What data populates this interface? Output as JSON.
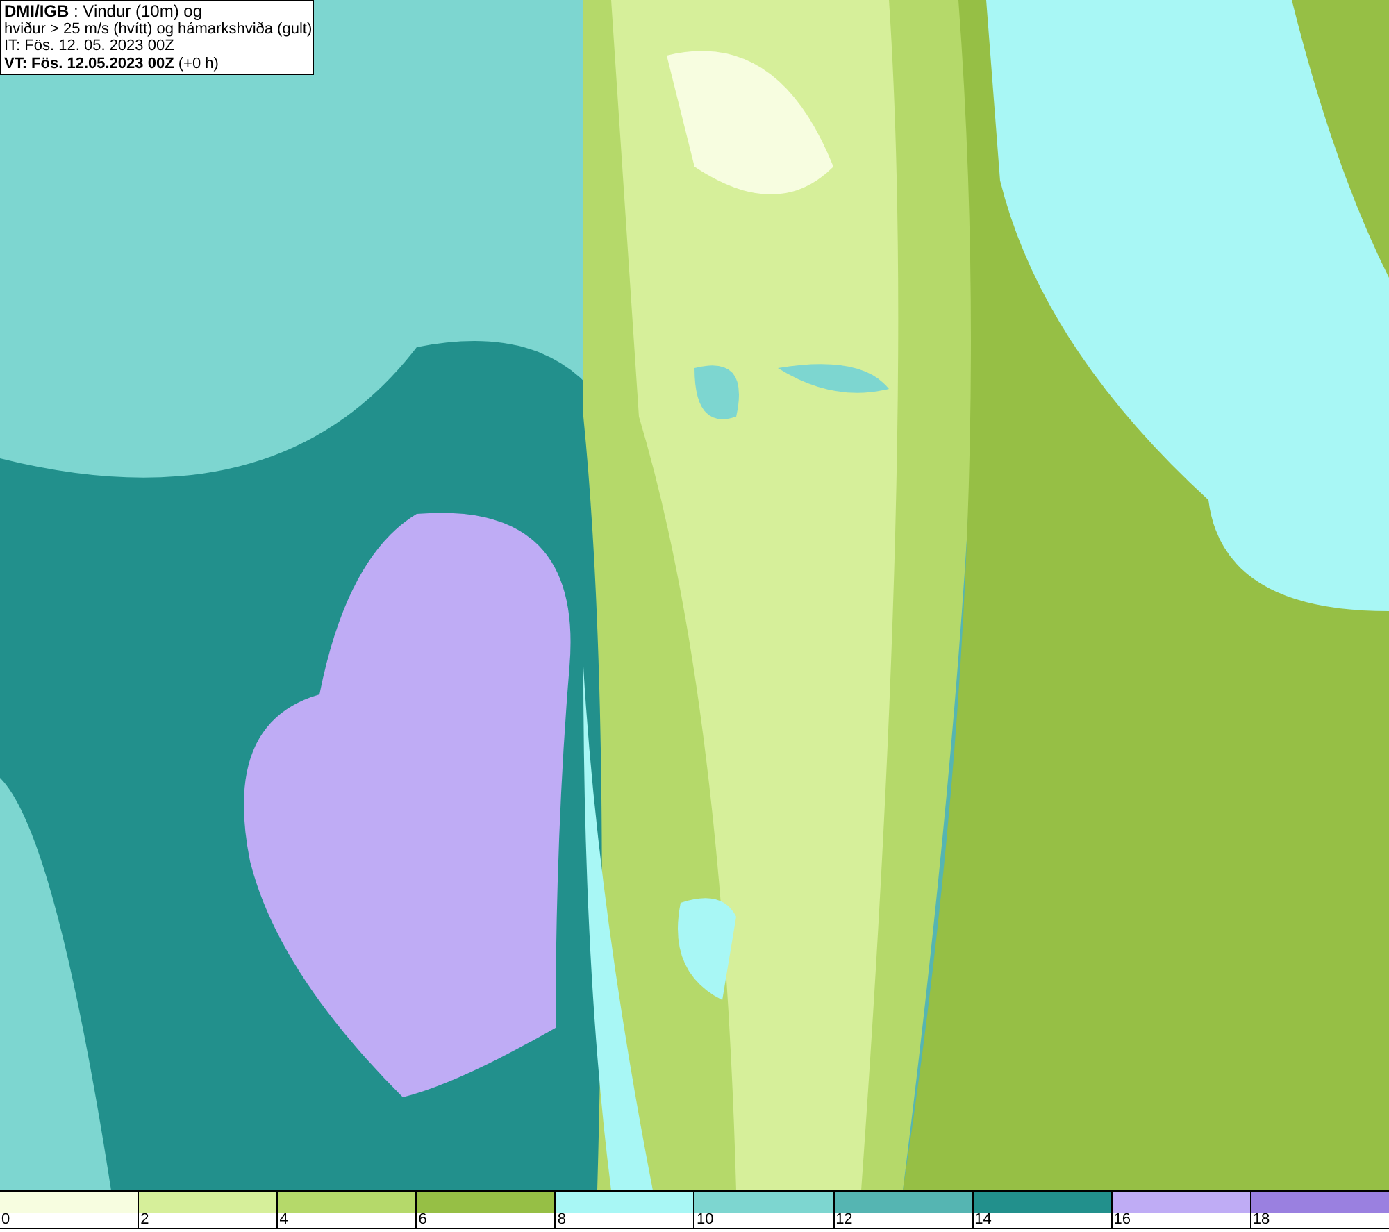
{
  "info_box": {
    "lines": [
      "**DMI/IGB** : Vindur (10m) og",
      "hviður > 25 m/s (hvítt) og hámarkshviða (gult)",
      "IT: Fös. 12. 05. 2023 00Z",
      "**VT: Fös. 12.05.2023 00Z** (+0 h)"
    ]
  },
  "legend": [
    {
      "color": "#f7fde0",
      "label": "0"
    },
    {
      "color": "#d6ef9a",
      "label": "2"
    },
    {
      "color": "#b5d96a",
      "label": "4"
    },
    {
      "color": "#96bf45",
      "label": "6"
    },
    {
      "color": "#a8f7f5",
      "label": "8"
    },
    {
      "color": "#7dd6d0",
      "label": "10"
    },
    {
      "color": "#55b5b2",
      "label": "12"
    },
    {
      "color": "#22908c",
      "label": "14"
    },
    {
      "color": "#bfacf5",
      "label": "16"
    },
    {
      "color": "#9a80e0",
      "label": "18"
    }
  ]
}
